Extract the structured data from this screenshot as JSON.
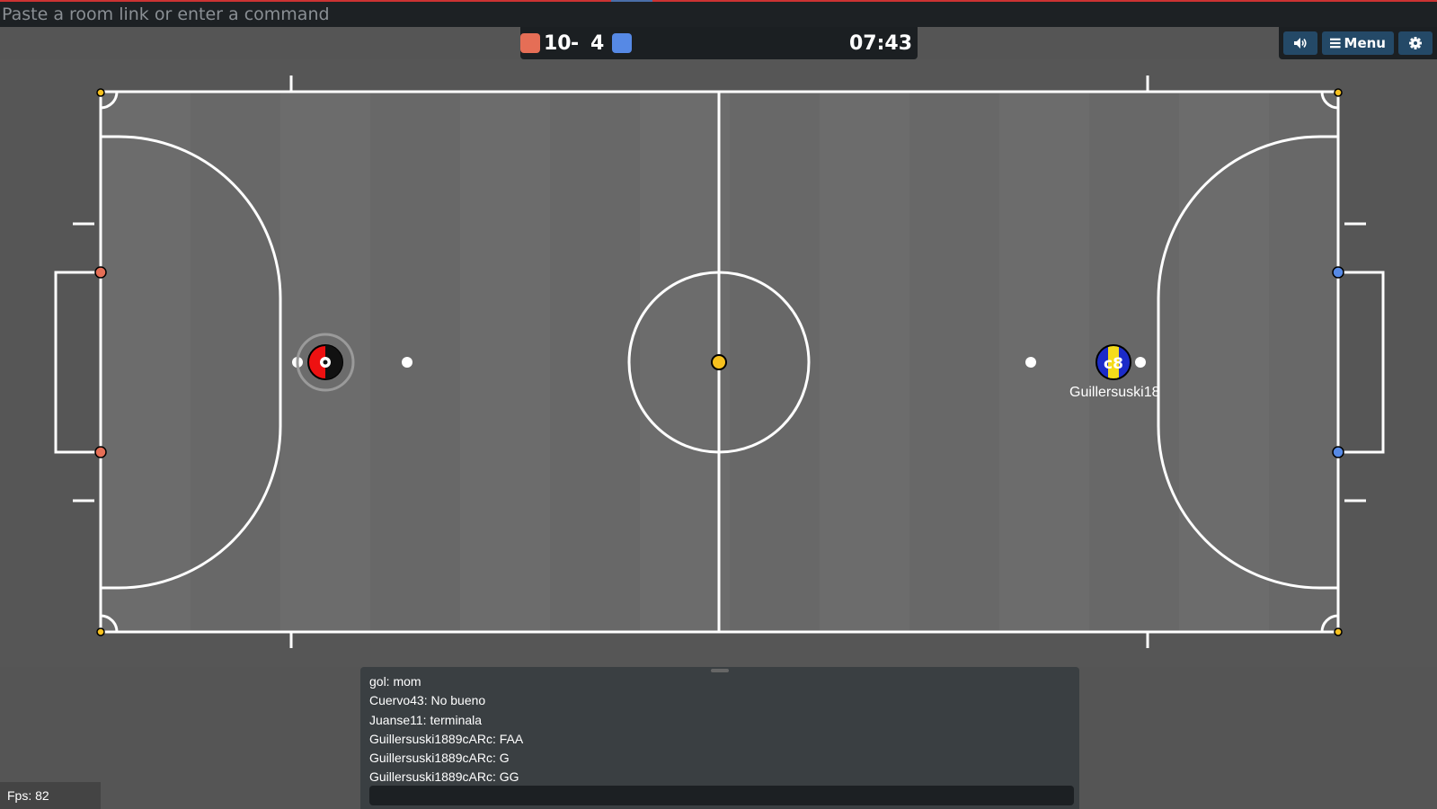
{
  "command_bar": {
    "placeholder": "Paste a room link or enter a command"
  },
  "scoreboard": {
    "red_score": "10",
    "separator": "-",
    "blue_score": "4",
    "timer": "07:43",
    "red_color": "#e56e56",
    "blue_color": "#5689e5"
  },
  "toolbar": {
    "sound_icon": "speaker-icon",
    "menu_icon": "hamburger-icon",
    "menu_label": "Menu",
    "settings_icon": "gear-icon"
  },
  "players": {
    "red": {
      "avatar": "",
      "name": ""
    },
    "blue": {
      "avatar": "c8",
      "name": "Guillersuski18"
    }
  },
  "chat": {
    "messages": [
      "gol: mom",
      "Cuervo43: No bueno",
      "Juanse11: terminala",
      "Guillersuski1889cARc: FAA",
      "Guillersuski1889cARc: G",
      "Guillersuski1889cARc: GG"
    ],
    "input_value": ""
  },
  "fps": {
    "label": "Fps: 82"
  },
  "colors": {
    "field_bg": "#6b6b6b",
    "outside_bg": "#555555",
    "line": "#ffffff",
    "ball": "#f7c11e",
    "red_post": "#e56e56",
    "blue_post": "#5689e5"
  }
}
